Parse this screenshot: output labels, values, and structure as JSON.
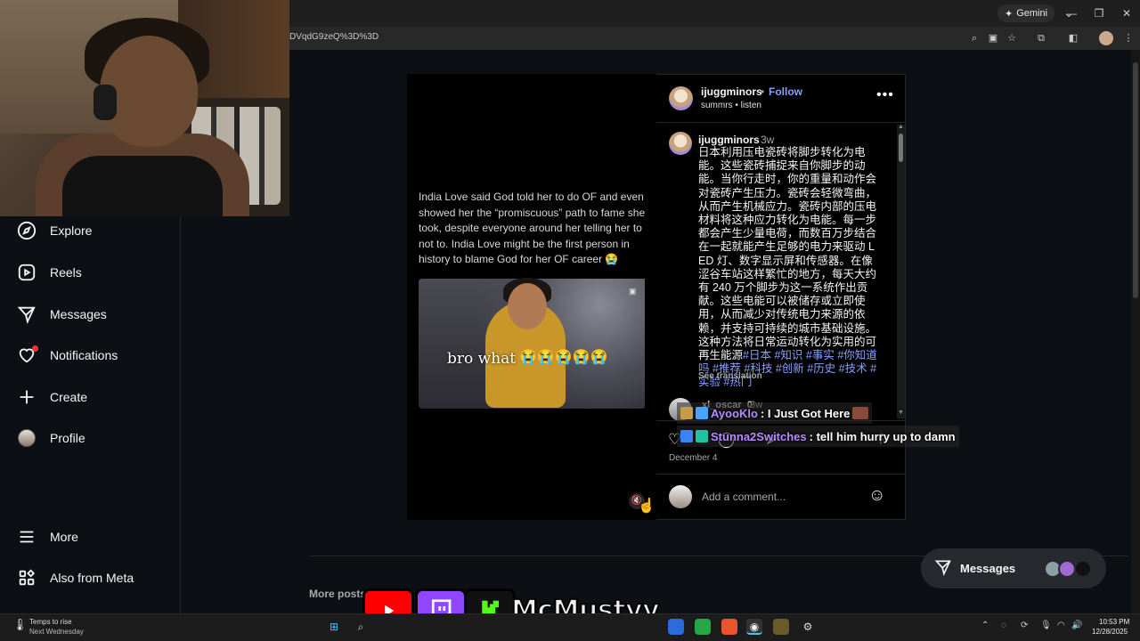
{
  "browser": {
    "gemini_label": "Gemini",
    "url": "DVqdG9zeQ%3D%3D",
    "window_controls": [
      "chevron-down-icon",
      "minimize-icon",
      "restore-icon",
      "close-icon"
    ],
    "toolbar_icons": [
      "zoom-icon",
      "cast-icon",
      "star-icon",
      "extensions-icon",
      "sidepanel-icon",
      "profile-avatar",
      "menu-icon"
    ]
  },
  "sidebar": {
    "items": [
      {
        "label": "Explore",
        "icon": "compass-icon"
      },
      {
        "label": "Reels",
        "icon": "reels-icon"
      },
      {
        "label": "Messages",
        "icon": "messenger-icon"
      },
      {
        "label": "Notifications",
        "icon": "heart-icon"
      },
      {
        "label": "Create",
        "icon": "plus-icon"
      },
      {
        "label": "Profile",
        "icon": "profile-avatar"
      }
    ],
    "bottom_items": [
      {
        "label": "More",
        "icon": "hamburger-icon"
      },
      {
        "label": "Also from Meta",
        "icon": "meta-grid-icon"
      }
    ]
  },
  "post": {
    "media_caption": "India Love said God told her to do OF and even showed her the “promiscuous” path to fame she took, despite everyone around her telling her to not to. India Love might be the first person in history to blame God for her OF career 😭",
    "clip_text": "bro what",
    "clip_emoji": "😭😭😭😭😭",
    "header": {
      "username": "ijuggminors",
      "separator": "•",
      "follow_label": "Follow",
      "audio": "summrs • listen"
    },
    "caption": {
      "username": "ijuggminors",
      "time": "3w",
      "text": "日本利用压电瓷砖将脚步转化为电能。这些瓷砖捕捉来自你脚步的动能。当你行走时，你的重量和动作会对瓷砖产生压力。瓷砖会轻微弯曲，从而产生机械应力。瓷砖内部的压电材料将这种应力转化为电能。每一步都会产生少量电荷，而数百万步结合在一起就能产生足够的电力来驱动 LED 灯、数字显示屏和传感器。在像涩谷车站这样繁忙的地方，每天大约有 240 万个脚步为这一系统作出贡献。这些电能可以被储存或立即使用，从而减少对传统电力来源的依赖，并支持可持续的城市基础设施。这种方法将日常运动转化为实用的可再生能源",
      "hashtags": "#日本 #知识 #事实 #你知道吗 #推荐 #科技 #创新 #历史 #技术 #实验 #热门",
      "see_translation": "See translation"
    },
    "first_comment": {
      "username": "xl_oscar_0",
      "time": "3w"
    },
    "date": "December 4",
    "comment_placeholder": "Add a comment..."
  },
  "chat_overlay": [
    {
      "nick": "AyooKlo",
      "message": ": I Just Got Here"
    },
    {
      "nick": "Stunna2Switches",
      "message": ": tell him hurry up to damn"
    }
  ],
  "more_posts_label": "More posts",
  "messages_pill": {
    "label": "Messages"
  },
  "stream_banner": {
    "name": "McMustyy"
  },
  "taskbar": {
    "weather_title": "Temps to rise",
    "weather_sub": "Next Wednesday",
    "time": "10:53 PM",
    "date": "12/28/2025"
  },
  "colors": {
    "background": "#0c1014",
    "link_blue": "#85a1ff",
    "twitch_purple": "#9146ff",
    "youtube_red": "#ff0000",
    "notification_red": "#ff3040"
  }
}
